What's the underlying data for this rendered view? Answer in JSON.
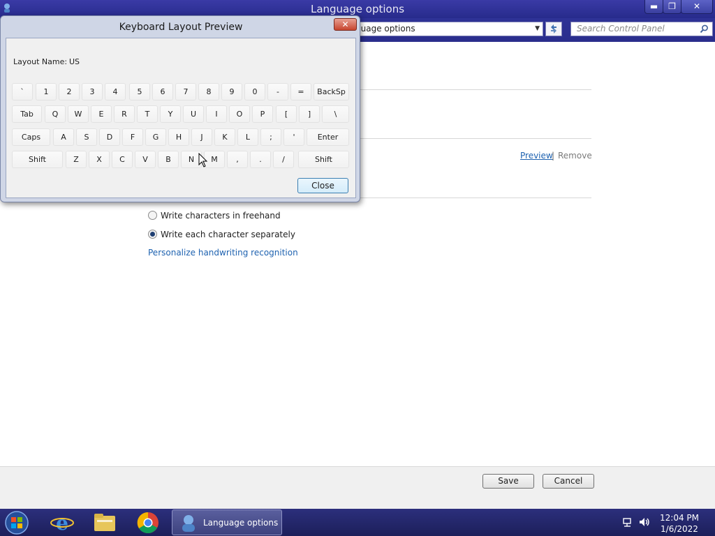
{
  "window": {
    "title": "Language options",
    "address": "guage options",
    "search_placeholder": "Search Control Panel",
    "caption": {
      "minimize": "▬",
      "maximize": "❐",
      "close": "✕"
    }
  },
  "content": {
    "preview_link": "Preview",
    "separator": "|",
    "remove_link": "Remove",
    "handwriting": {
      "options": [
        {
          "label": "Write characters in freehand",
          "selected": false
        },
        {
          "label": "Write each character separately",
          "selected": true
        }
      ],
      "personalize_link": "Personalize handwriting recognition"
    },
    "save_label": "Save",
    "cancel_label": "Cancel"
  },
  "dialog": {
    "title": "Keyboard Layout Preview",
    "close_glyph": "✕",
    "layout_name_label": "Layout Name:",
    "layout_name_value": "US",
    "keyboard_rows": [
      [
        "`",
        "1",
        "2",
        "3",
        "4",
        "5",
        "6",
        "7",
        "8",
        "9",
        "0",
        "-",
        "=",
        "BackSp"
      ],
      [
        "Tab",
        "Q",
        "W",
        "E",
        "R",
        "T",
        "Y",
        "U",
        "I",
        "O",
        "P",
        "[",
        "]",
        "\\"
      ],
      [
        "Caps",
        "A",
        "S",
        "D",
        "F",
        "G",
        "H",
        "J",
        "K",
        "L",
        ";",
        "'",
        "Enter"
      ],
      [
        "Shift",
        "Z",
        "X",
        "C",
        "V",
        "B",
        "N",
        "M",
        ",",
        ".",
        "/",
        "Shift"
      ]
    ],
    "close_label": "Close"
  },
  "taskbar": {
    "pinned": [
      "internet-explorer-icon",
      "file-explorer-icon",
      "chrome-icon"
    ],
    "task_label": "Language options",
    "time": "12:04 PM",
    "date": "1/6/2022"
  },
  "colors": {
    "titlebar": "#2c3092",
    "link": "#1e62b0",
    "taskbar": "#23266c",
    "dialog_frame": "#cfd6e6"
  }
}
